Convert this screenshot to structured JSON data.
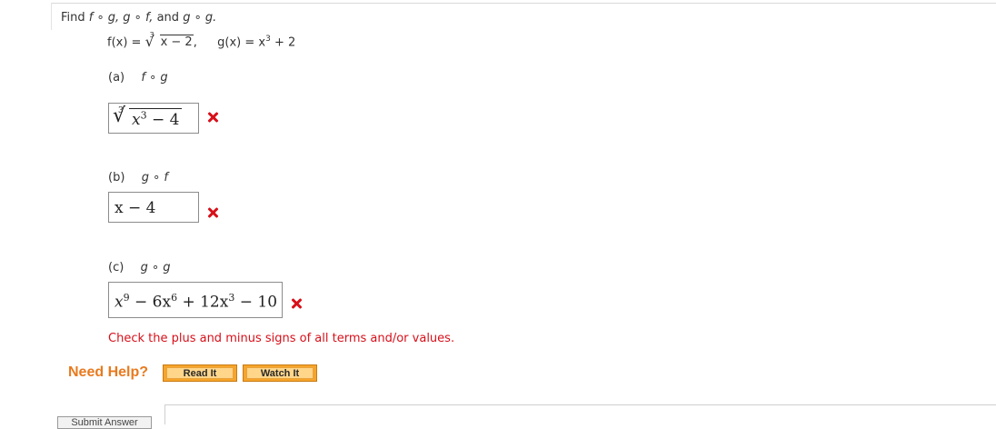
{
  "question": {
    "prompt_find": "Find",
    "prompt_fog": "f ∘ g,",
    "prompt_gof": "g ∘ f,",
    "prompt_and": "and",
    "prompt_gog": "g ∘ g.",
    "f_def_prefix": "f(x) = ",
    "f_root_index": "3",
    "f_radicand": "x − 2",
    "f_def_suffix": ",",
    "g_def_prefix": "g(x) = x",
    "g_exp": "3",
    "g_def_suffix": " + 2"
  },
  "parts": [
    {
      "letter": "(a)",
      "operation": "f ∘ g",
      "answer": {
        "root_index": "3",
        "base": "x",
        "exp": "3",
        "rest": " − 4"
      },
      "status": "incorrect"
    },
    {
      "letter": "(b)",
      "operation": "g ∘ f",
      "answer": {
        "text": "x − 4"
      },
      "status": "incorrect"
    },
    {
      "letter": "(c)",
      "operation": "g ∘ g",
      "answer": {
        "t1": "x",
        "e1": "9",
        "t2": " − 6x",
        "e2": "6",
        "t3": " + 12x",
        "e3": "3",
        "t4": " − 10"
      },
      "status": "incorrect"
    }
  ],
  "feedback": "Check the plus and minus signs of all terms and/or values.",
  "help": {
    "label": "Need Help?",
    "read_it": "Read It",
    "watch_it": "Watch It"
  },
  "submit": "Submit Answer",
  "colors": {
    "error_red": "#d7101a",
    "help_orange": "#e87a1e",
    "button_orange": "#f7a42b"
  }
}
